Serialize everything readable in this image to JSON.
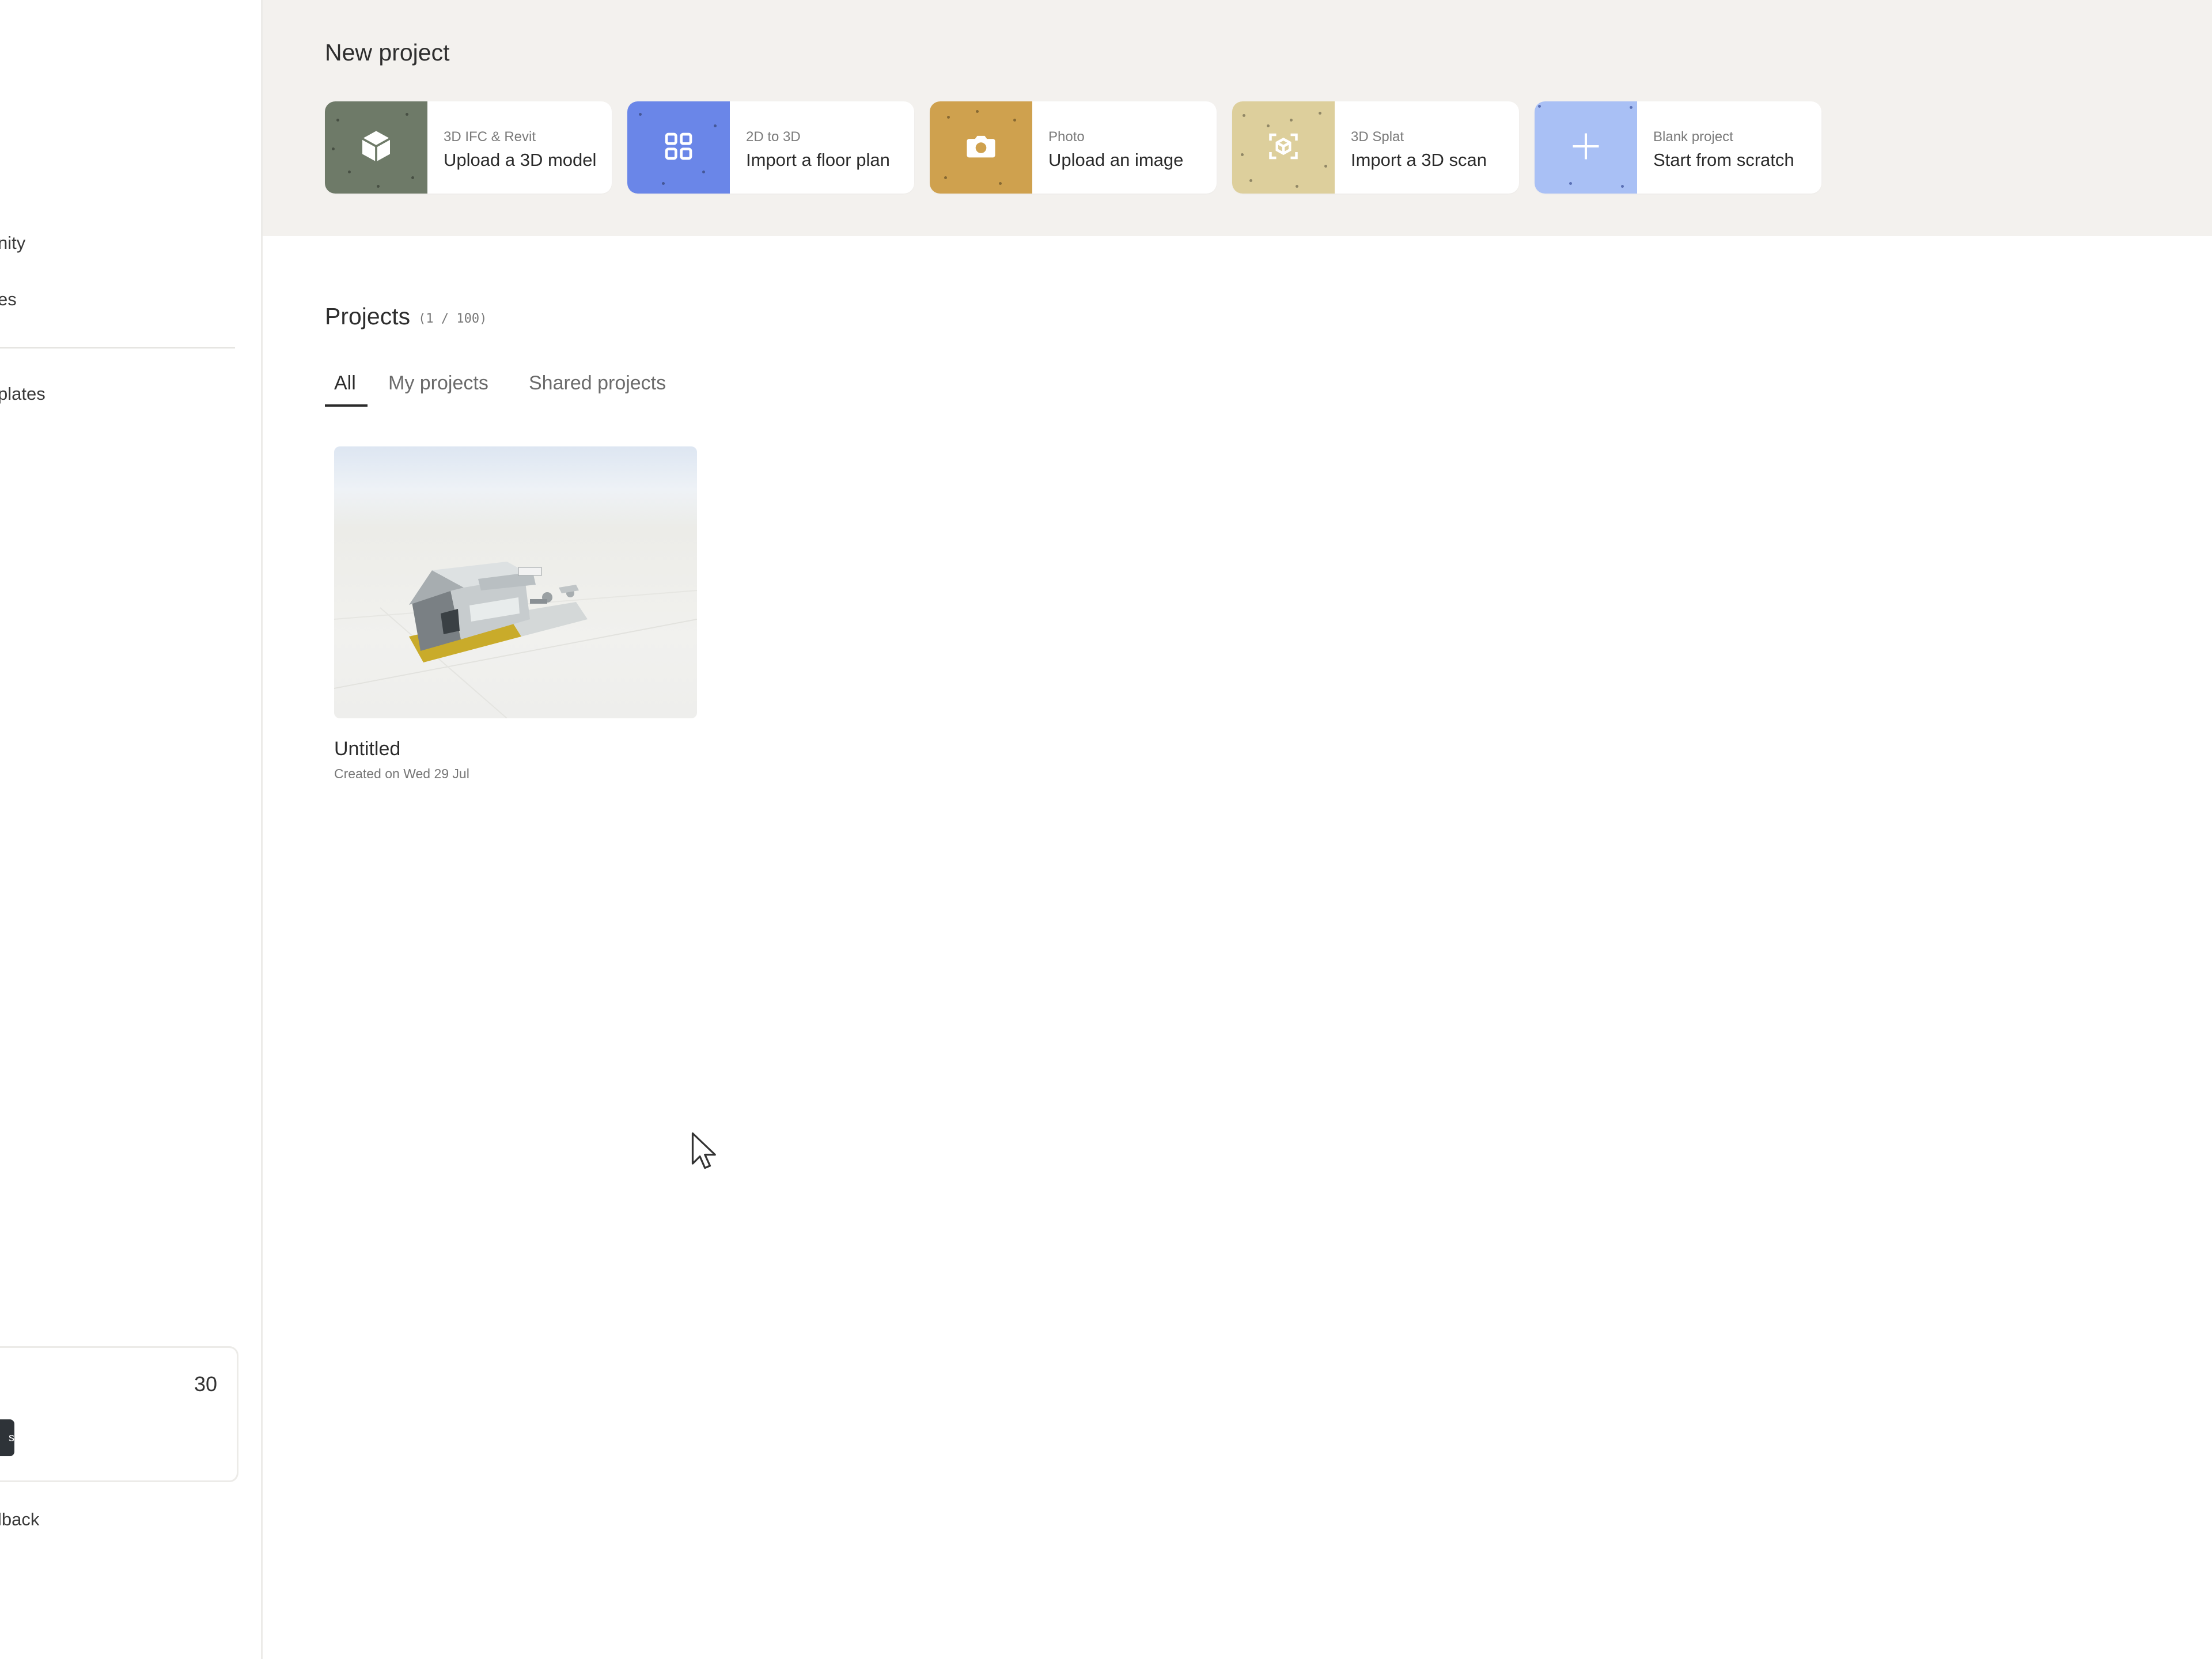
{
  "sidebar": {
    "items": [
      {
        "label": "nity"
      },
      {
        "label": "es"
      },
      {
        "label": "plates"
      }
    ],
    "credits": {
      "count": "30",
      "button_label": "s"
    },
    "feedback_label": "lback"
  },
  "new_project": {
    "title": "New project",
    "cards": [
      {
        "small": "3D IFC & Revit",
        "main": "Upload a 3D model",
        "icon": "cube-icon",
        "color": "#6e7a68"
      },
      {
        "small": "2D to 3D",
        "main": "Import a floor plan",
        "icon": "grid-icon",
        "color": "#6a86e8"
      },
      {
        "small": "Photo",
        "main": "Upload an image",
        "icon": "camera-icon",
        "color": "#cfa14e"
      },
      {
        "small": "3D Splat",
        "main": "Import a 3D scan",
        "icon": "scan-icon",
        "color": "#ddcf9c"
      },
      {
        "small": "Blank project",
        "main": "Start from scratch",
        "icon": "plus-icon",
        "color": "#a9c0f5"
      }
    ]
  },
  "projects": {
    "title": "Projects",
    "count": "(1 / 100)",
    "tabs": [
      {
        "label": "All",
        "active": true
      },
      {
        "label": "My projects",
        "active": false
      },
      {
        "label": "Shared projects",
        "active": false
      }
    ],
    "items": [
      {
        "name": "Untitled",
        "created": "Created on Wed 29 Jul"
      }
    ]
  }
}
